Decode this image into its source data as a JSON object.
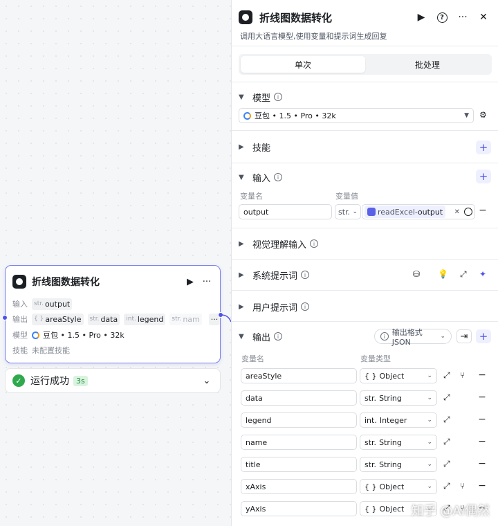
{
  "node": {
    "title": "折线图数据转化",
    "input_label": "输入",
    "input_tag": {
      "type": "str.",
      "name": "output"
    },
    "output_label": "输出",
    "output_tags": [
      {
        "type": "{ }",
        "name": "areaStyle"
      },
      {
        "type": "str.",
        "name": "data"
      },
      {
        "type": "int.",
        "name": "legend"
      },
      {
        "type": "str.",
        "name": "nam"
      }
    ],
    "more": "···",
    "model_label": "模型",
    "model_value": "豆包 • 1.5 • Pro • 32k",
    "skill_label": "技能",
    "skill_value": "未配置技能"
  },
  "status": {
    "text": "运行成功",
    "time": "3s"
  },
  "panel": {
    "title": "折线图数据转化",
    "description": "调用大语言模型,使用变量和提示词生成回复",
    "tabs": [
      "单次",
      "批处理"
    ],
    "model_section": "模型",
    "model_value": "豆包 • 1.5 • Pro • 32k",
    "skill_section": "技能",
    "input_section": "输入",
    "input_col_name": "变量名",
    "input_col_value": "变量值",
    "input_var_name": "output",
    "input_var_type": "str.",
    "input_ref_node": "readExcel",
    "input_ref_sep": " - ",
    "input_ref_var": "output",
    "vision_section": "视觉理解输入",
    "system_prompt_section": "系统提示词",
    "user_prompt_section": "用户提示词",
    "output_section": "输出",
    "output_format": "输出格式JSON",
    "output_col_name": "变量名",
    "output_col_type": "变量类型",
    "outputs": [
      {
        "name": "areaStyle",
        "type_prefix": "{ }",
        "type": "Object",
        "expand": true
      },
      {
        "name": "data",
        "type_prefix": "str.",
        "type": "String",
        "expand": false
      },
      {
        "name": "legend",
        "type_prefix": "int.",
        "type": "Integer",
        "expand": false
      },
      {
        "name": "name",
        "type_prefix": "str.",
        "type": "String",
        "expand": false
      },
      {
        "name": "title",
        "type_prefix": "str.",
        "type": "String",
        "expand": false
      },
      {
        "name": "xAxis",
        "type_prefix": "{ }",
        "type": "Object",
        "expand": true
      },
      {
        "name": "yAxis",
        "type_prefix": "{ }",
        "type": "Object",
        "expand": true
      }
    ]
  },
  "watermark": "知乎 @AI偶然",
  "colors": {
    "accent": "#4d53e8",
    "success": "#2fa94e",
    "node_border": "#7b80ee"
  }
}
